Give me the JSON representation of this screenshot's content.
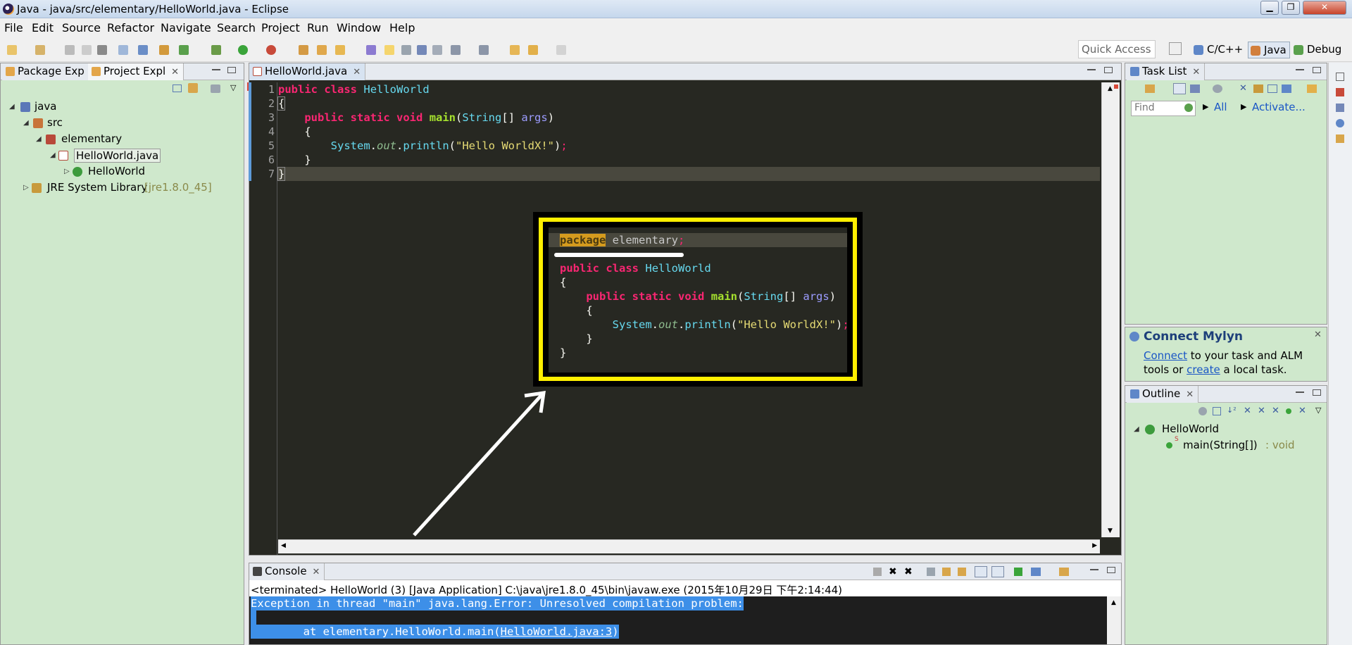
{
  "window": {
    "title": "Java - java/src/elementary/HelloWorld.java - Eclipse"
  },
  "menu": [
    "File",
    "Edit",
    "Source",
    "Refactor",
    "Navigate",
    "Search",
    "Project",
    "Run",
    "Window",
    "Help"
  ],
  "toolbar": {
    "quick_access_placeholder": "Quick Access"
  },
  "perspectives": [
    "C/C++",
    "Java",
    "Debug"
  ],
  "left_panel": {
    "tabs": [
      "Package Exp",
      "Project Expl"
    ],
    "tree": {
      "project": "java",
      "src": "src",
      "package": "elementary",
      "file": "HelloWorld.java",
      "class": "HelloWorld",
      "library": "JRE System Library",
      "library_version": "[jre1.8.0_45]"
    }
  },
  "editor": {
    "tab": "HelloWorld.java",
    "line_numbers": [
      "1",
      "2",
      "3",
      "4",
      "5",
      "6",
      "7"
    ]
  },
  "overlay": {
    "package_kw": "package",
    "package_name": "elementary"
  },
  "console": {
    "tab": "Console",
    "status": "<terminated> HelloWorld (3) [Java Application] C:\\java\\jre1.8.0_45\\bin\\javaw.exe (2015年10月29日 下午2:14:44)",
    "line1": "Exception in thread \"main\" java.lang.Error: Unresolved compilation problem:",
    "line3_prefix": "        at elementary.HelloWorld.main(",
    "line3_link": "HelloWorld.java:3",
    "line3_suffix": ")"
  },
  "task_list": {
    "tab": "Task List",
    "find_placeholder": "Find",
    "all": "All",
    "activate": "Activate..."
  },
  "mylyn": {
    "title": "Connect Mylyn",
    "connect": "Connect",
    "text1": " to your task and ALM",
    "text2": "tools or ",
    "create": "create",
    "text3": " a local task."
  },
  "outline": {
    "tab": "Outline",
    "class": "HelloWorld",
    "method": "main(String[])",
    "method_type": " : void"
  },
  "colors": {
    "editor_bg": "#272822",
    "panel_bg": "#cfe8cc",
    "overlay_border": "#ffef00",
    "selection": "#3d8fe8"
  }
}
